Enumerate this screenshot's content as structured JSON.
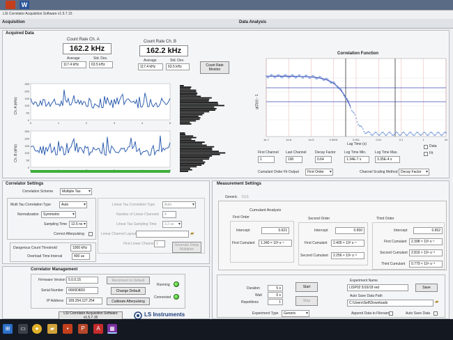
{
  "top_bar": {
    "word_icon": "W"
  },
  "window": {
    "title": "LSI Correlator Acquisition Software v1.5.7.15"
  },
  "tabs": {
    "acquisition": "Acquisition",
    "data_analysis": "Data Analysis"
  },
  "acquired": {
    "title": "Acquired Data",
    "ch_a": {
      "header": "Count Rate  Ch. A",
      "value": "162.2  kHz",
      "avg_label": "Average",
      "std_label": "Std. Dev.",
      "avg": "117.4 kHz",
      "std": "63.5 kHz"
    },
    "ch_b": {
      "header": "Count Rate  Ch. B",
      "value": "162.2  kHz",
      "avg_label": "Average",
      "std_label": "Std. Dev.",
      "avg": "117.4 kHz",
      "std": "63.5 kHz"
    },
    "monitor_button": "Count Rate Monitor",
    "plot_a_ylabel": "Ch. A (kHz)",
    "plot_b_ylabel": "Ch. B (kHz)",
    "y_ticks": [
      "250",
      "200",
      "150",
      "100",
      "50",
      "0"
    ],
    "x_ticks": [
      "0",
      "1",
      "2",
      "3",
      "4",
      "5"
    ]
  },
  "correlation": {
    "title": "Correlation Function",
    "x_label": "Lag Time (s)",
    "y_label": "g(2)(τ) - 1",
    "x_ticks": [
      "1e-7",
      "1e-6",
      "1e-5",
      "0.0001",
      "0.001",
      "0.01",
      "0.1",
      "1",
      "10"
    ],
    "fields": [
      {
        "label": "First Channel",
        "value": "1"
      },
      {
        "label": "Last Channel",
        "value": "190"
      },
      {
        "label": "Decay Factor",
        "value": "0.64"
      },
      {
        "label": "Log Time Min.",
        "value": "1.34E-7 s"
      },
      {
        "label": "Log Time Max.",
        "value": "3.35E-4 s"
      }
    ],
    "legend_data": "Data",
    "legend_fit": "Fit",
    "cumulant_order_label": "Cumulant Order Fit Output",
    "cumulant_order_value": "First Order",
    "scaling_label": "Channel Scaling Method",
    "scaling_value": "Decay Factor"
  },
  "correlator_settings": {
    "title": "Correlator Settings",
    "scheme_label": "Correlation Scheme",
    "scheme_value": "Multiple Tau",
    "mt_type_label": "Multi Tau Correlation Type",
    "mt_type_value": "Auto",
    "norm_label": "Normalization",
    "norm_value": "Symmetric",
    "sampling_label": "Sampling Time",
    "sampling_value": "12.5 ns",
    "correct_label": "Correct Afterpulsing",
    "lin_type_label": "Linear Tau Correlation Type",
    "lin_type_value": "Auto",
    "lin_num_label": "Number of Linear Channels",
    "lin_num_value": "4",
    "lin_sampling_label": "Linear Tau Sampling Time",
    "lin_sampling_value": "3.2 us",
    "lin_layout_label": "Linear Channel Layout",
    "first_lin_label": "First Linear Channel",
    "first_lin_value": "1",
    "gen_delay_button": "Generate Delay Multiples",
    "dangerous_label": "Dangerous Count Threshold",
    "dangerous_value": "1000 kHz",
    "overload_label": "Overload Time Interval",
    "overload_value": "400 us"
  },
  "correlator_mgmt": {
    "title": "Correlator Management",
    "fw_label": "Firmware Version",
    "fw_value": "5.0.0.15",
    "serial_label": "Serial Number",
    "serial_value": "0000D8D0",
    "ip_label": "IP Address",
    "ip_value": "169.254.127.254",
    "reconnect": "Reconnect to Default",
    "change_default": "Change Default",
    "calibrate": "Calibrate Afterpulsing",
    "running": "Running",
    "connected": "Connected",
    "version_button": "LSI Correlator Acquisition Software v1.5.7.15",
    "logo_text": "LS Instruments"
  },
  "measurement": {
    "title": "Measurement Settings",
    "tab_generic": "Generic",
    "tab_dls": "DLS",
    "cumulant_title": "Cumulant Analysis",
    "first_order": "First Order",
    "second_order": "Second Order",
    "third_order": "Third Order",
    "intercept_label": "Intercept",
    "first_cumulant_label": "First Cumulant",
    "second_cumulant_label": "Second Cumulant",
    "third_cumulant_label": "Third Cumulant",
    "fo_intercept": "0.621",
    "fo_first": "1.340 × 10³ s⁻¹",
    "so_intercept": "0.650",
    "so_first": "2.405 × 10³ s⁻¹",
    "so_second": "2.256 × 10⁶ s⁻²",
    "to_intercept": "0.652",
    "to_first": "2.398 × 10³ s⁻¹",
    "to_second": "2.816 × 10⁶ s⁻²",
    "to_third": "0.779 × 10⁹ s⁻³",
    "duration_label": "Duration",
    "duration_value": "5 s",
    "wait_label": "Wait",
    "wait_value": "0 s",
    "repetitions_label": "Repetitions",
    "repetitions_value": "1",
    "start": "Start",
    "stop": "Stop",
    "exp_name_label": "Experiment Name",
    "exp_name_value": "LISP02 5/16/18 red",
    "save": "Save",
    "autosave_label": "Auto Save Data Path",
    "autosave_value": "C:\\Users\\Sell\\Downloads",
    "exp_type_label": "Experiment Type",
    "exp_type_value": "Generic",
    "append_label": "Append Data to Filename",
    "autosave_chk_label": "Auto Save Data"
  },
  "colors": {
    "trace": "#2f5fb0",
    "fit": "#3b4db8",
    "green_bar": "#3fae3a",
    "accent_led": "#43c232"
  }
}
